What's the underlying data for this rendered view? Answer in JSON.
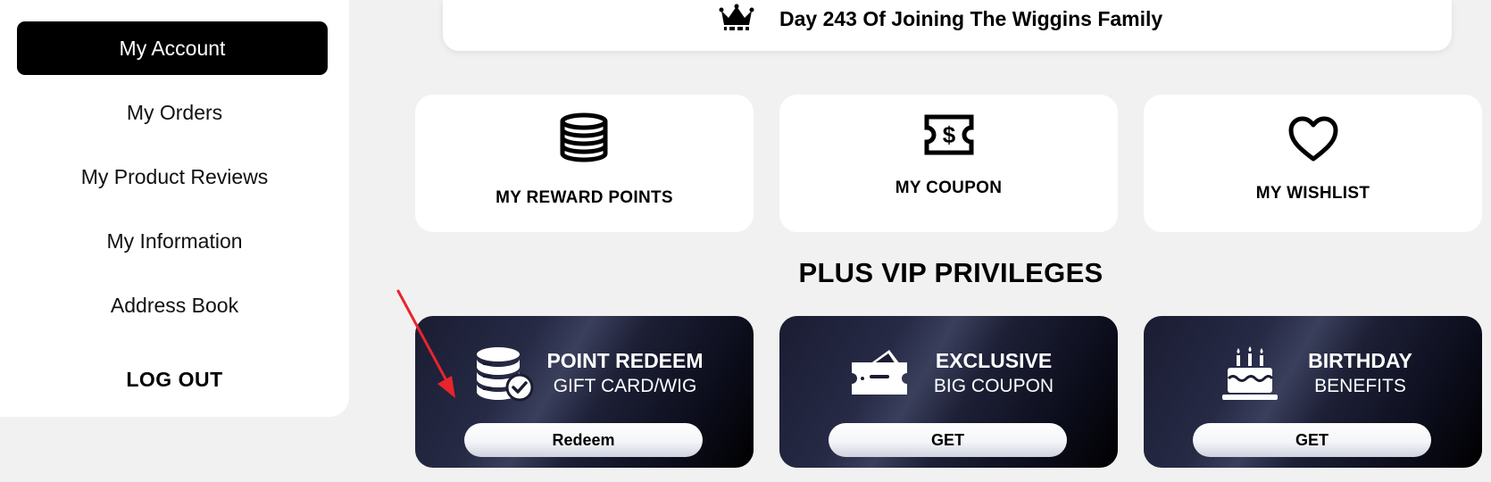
{
  "sidebar": {
    "items": [
      {
        "label": "My Account",
        "active": true
      },
      {
        "label": "My Orders"
      },
      {
        "label": "My Product Reviews"
      },
      {
        "label": "My Information"
      },
      {
        "label": "Address Book"
      }
    ],
    "logout": "LOG OUT"
  },
  "banner": {
    "icon": "crown-icon",
    "text": "Day 243 Of Joining The Wiggins Family"
  },
  "cards": [
    {
      "label": "MY REWARD POINTS",
      "icon": "coins-stack-icon"
    },
    {
      "label": "MY COUPON",
      "icon": "dollar-ticket-icon"
    },
    {
      "label": "MY WISHLIST",
      "icon": "heart-icon"
    }
  ],
  "vip": {
    "title": "PLUS VIP PRIVILEGES",
    "cards": [
      {
        "title": "POINT REDEEM",
        "subtitle": "GIFT CARD/WIG",
        "button": "Redeem",
        "icon": "database-check-icon"
      },
      {
        "title": "EXCLUSIVE",
        "subtitle": "BIG COUPON",
        "button": "GET",
        "icon": "coupon-ticket-icon"
      },
      {
        "title": "BIRTHDAY",
        "subtitle": "BENEFITS",
        "button": "GET",
        "icon": "birthday-cake-icon"
      }
    ]
  },
  "colors": {
    "background": "#f1f1f1",
    "active_nav": "#000000",
    "arrow": "#e8242c",
    "vip_dark": "#1a1c32"
  }
}
